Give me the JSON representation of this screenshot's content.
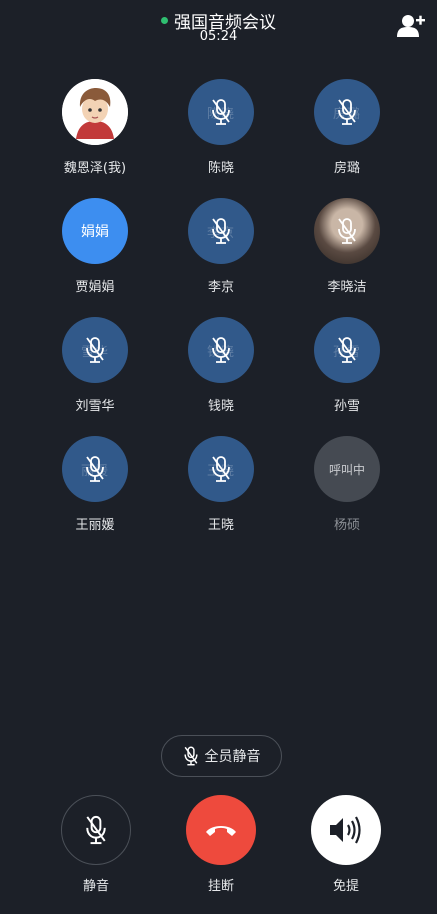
{
  "header": {
    "title": "强国音频会议",
    "timer": "05:24",
    "status_color": "#2fbf71",
    "add_icon": "add-user-icon"
  },
  "members": [
    {
      "name": "魏恩泽(我)",
      "state": "me",
      "ghost": ""
    },
    {
      "name": "陈晓",
      "state": "muted",
      "ghost": "陈晓"
    },
    {
      "name": "房璐",
      "state": "muted",
      "ghost": "房璐"
    },
    {
      "name": "贾娟娟",
      "state": "active",
      "ghost": "娟娟"
    },
    {
      "name": "李京",
      "state": "muted",
      "ghost": "李京"
    },
    {
      "name": "李晓洁",
      "state": "muted-photo",
      "ghost": ""
    },
    {
      "name": "刘雪华",
      "state": "muted",
      "ghost": "雪华"
    },
    {
      "name": "钱晓",
      "state": "muted",
      "ghost": "钱晓"
    },
    {
      "name": "孙雪",
      "state": "muted",
      "ghost": "孙雪"
    },
    {
      "name": "王丽媛",
      "state": "muted",
      "ghost": "丽媛"
    },
    {
      "name": "王晓",
      "state": "muted",
      "ghost": "王晓"
    },
    {
      "name": "杨硕",
      "state": "calling",
      "ghost": "呼叫中"
    }
  ],
  "mute_all": {
    "label": "全员静音",
    "icon": "mic-off-icon"
  },
  "controls": {
    "mute_label": "静音",
    "hangup_label": "挂断",
    "speaker_label": "免提",
    "hangup_color": "#ee4a3d"
  }
}
